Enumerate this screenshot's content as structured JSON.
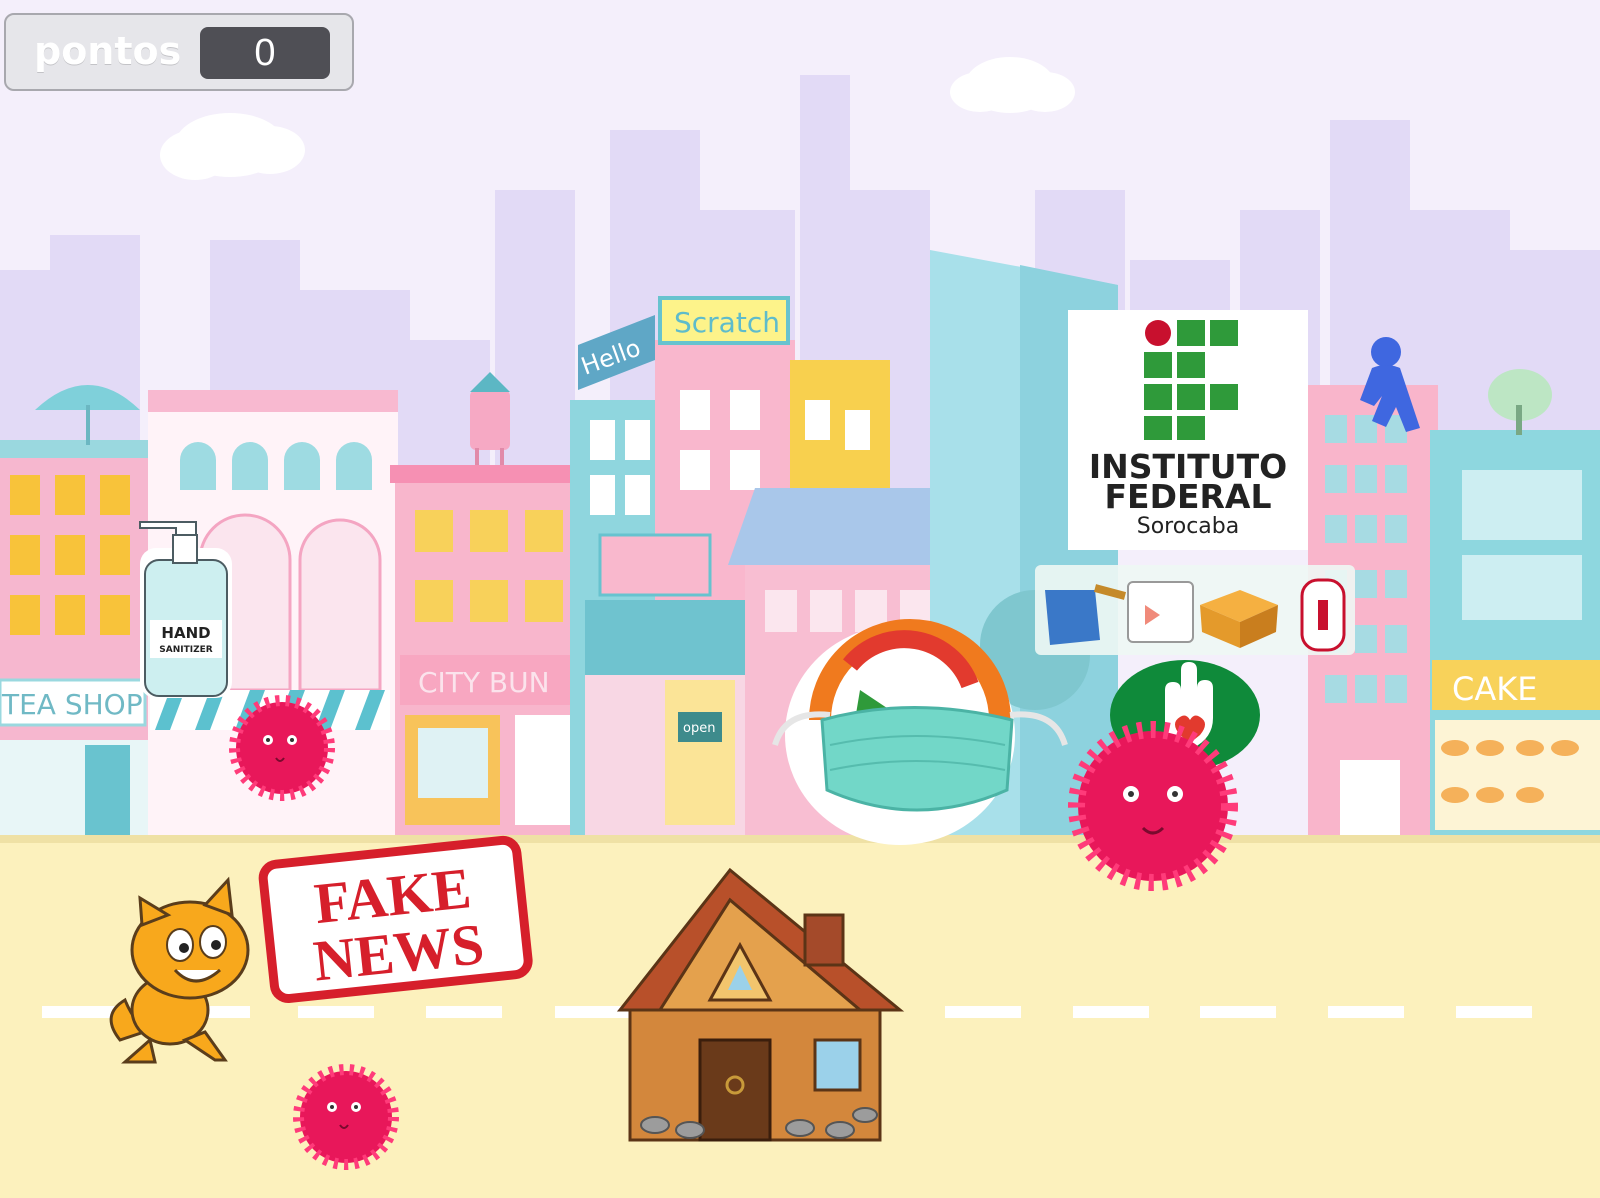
{
  "score_monitor": {
    "label": "pontos",
    "value": "0"
  },
  "buildings": {
    "hello_sign": "Hello",
    "scratch_sign": "Scratch",
    "tea_shop_sign": "TEA SHOP",
    "city_bun_sign": "CITY BUN",
    "cake_sign": "CAKE",
    "open_sign": "open"
  },
  "sprites": {
    "hand_sanitizer": {
      "line1": "HAND",
      "line2": "SANITIZER"
    },
    "fake_news": {
      "line1": "FAKE",
      "line2": "NEWS"
    },
    "ifsp_logo": {
      "line1": "INSTITUTO",
      "line2": "FEDERAL",
      "line3": "Sorocaba"
    }
  },
  "colors": {
    "sky": "#f3eefb",
    "skyline": "#dcd3f4",
    "road": "#fcf0b8",
    "virus": "#e8175a",
    "cat": "#f8a81c",
    "if_green": "#2f9a3a",
    "if_red": "#c8102e"
  }
}
